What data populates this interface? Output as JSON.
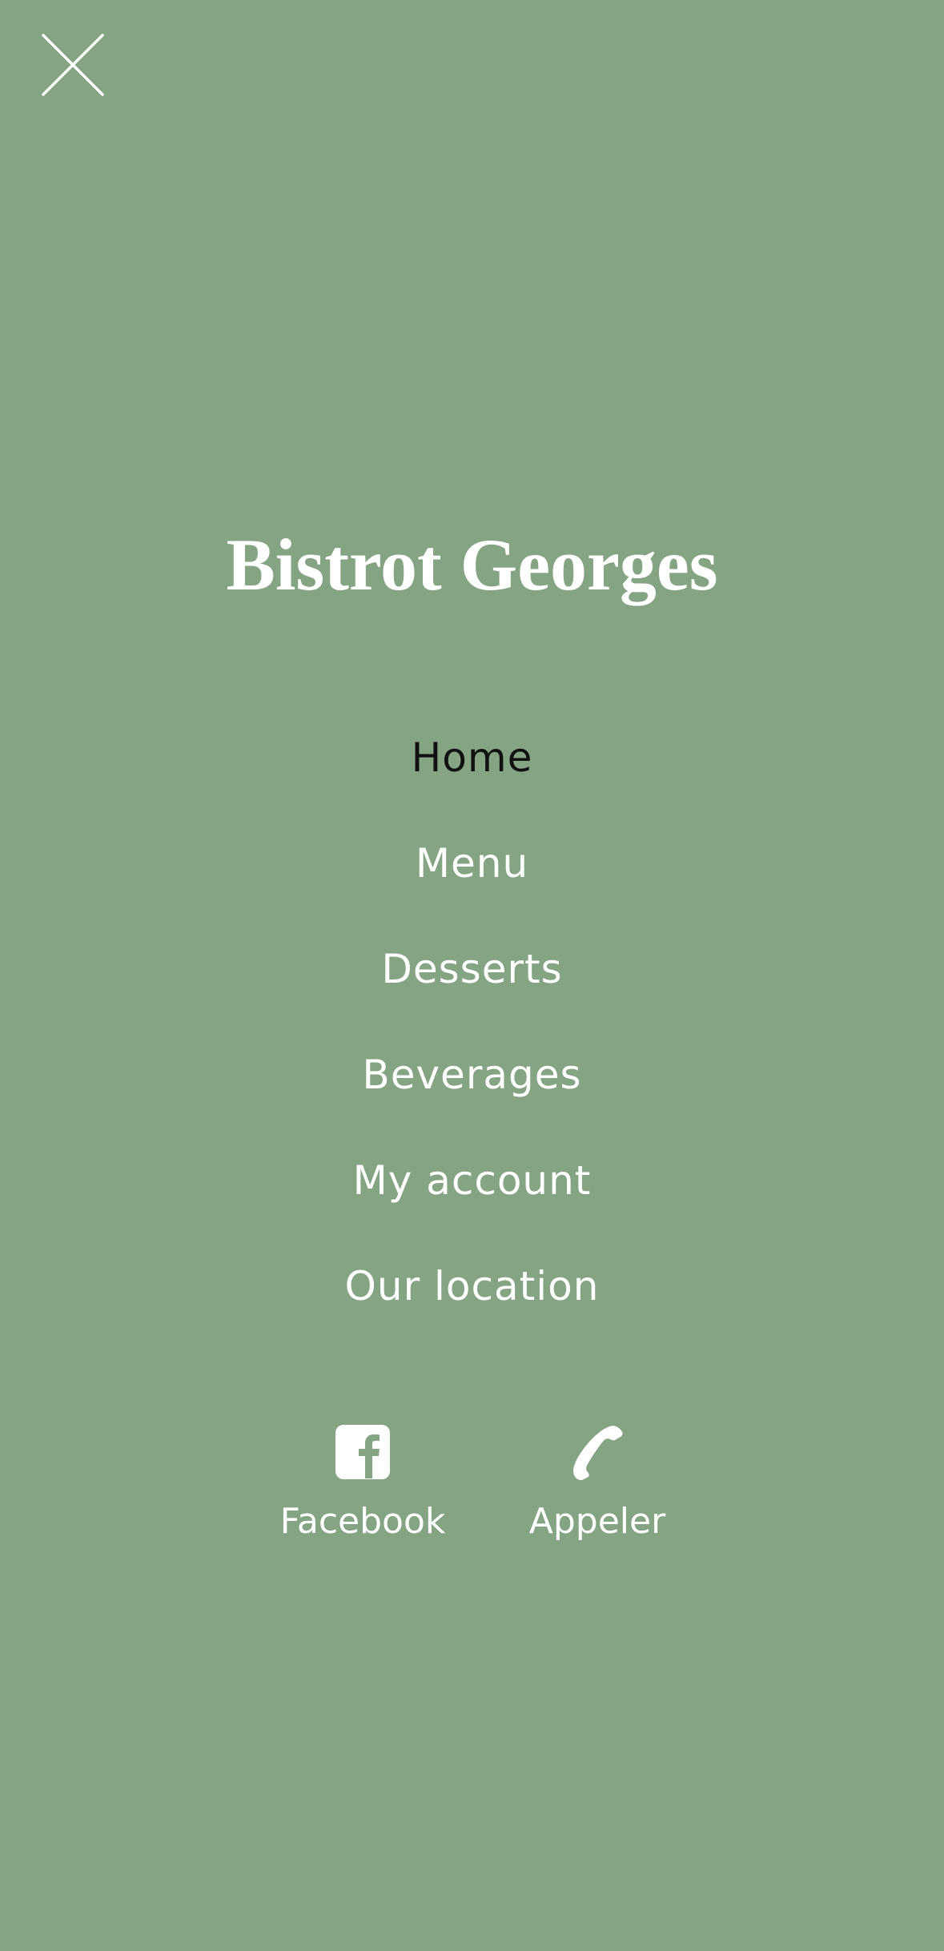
{
  "brand": {
    "title": "Bistrot Georges"
  },
  "nav": {
    "items": [
      {
        "label": "Home",
        "active": true
      },
      {
        "label": "Menu",
        "active": false
      },
      {
        "label": "Desserts",
        "active": false
      },
      {
        "label": "Beverages",
        "active": false
      },
      {
        "label": "My account",
        "active": false
      },
      {
        "label": "Our location",
        "active": false
      }
    ]
  },
  "social": {
    "facebook": {
      "label": "Facebook",
      "icon": "facebook-icon"
    },
    "call": {
      "label": "Appeler",
      "icon": "phone-icon"
    }
  },
  "colors": {
    "background": "#84a483",
    "text": "#ffffff",
    "active_text": "#111111"
  }
}
